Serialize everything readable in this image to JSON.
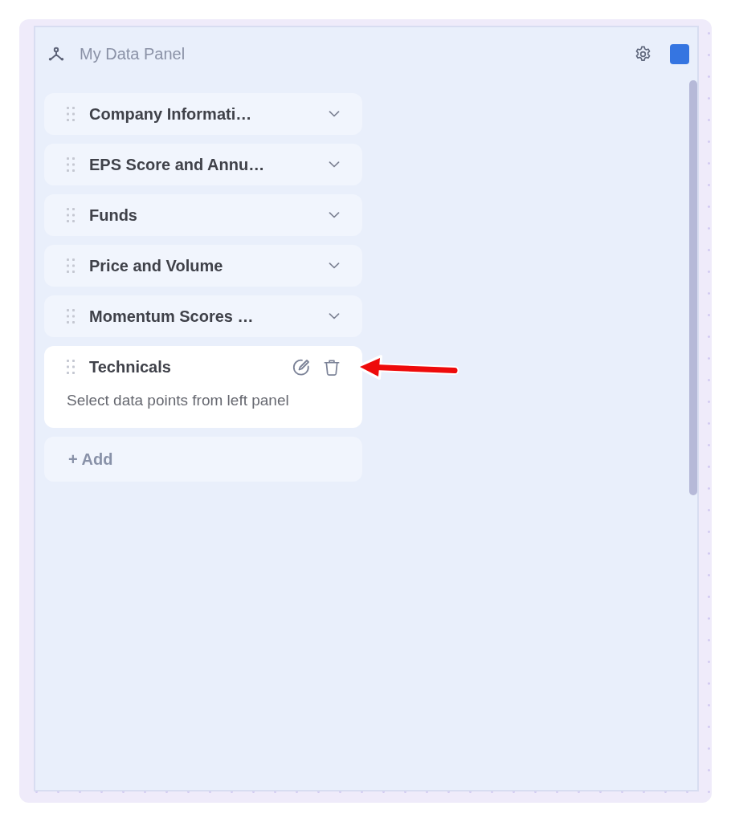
{
  "panel": {
    "title": "My Data Panel"
  },
  "sections": [
    {
      "title": "Company Informati…",
      "expanded": false
    },
    {
      "title": "EPS Score and Annu…",
      "expanded": false
    },
    {
      "title": "Funds",
      "expanded": false
    },
    {
      "title": "Price and Volume",
      "expanded": false
    },
    {
      "title": "Momentum Scores …",
      "expanded": false
    },
    {
      "title": "Technicals",
      "expanded": true,
      "hint": "Select data points from left panel"
    }
  ],
  "add_button": {
    "label": "+ Add"
  }
}
